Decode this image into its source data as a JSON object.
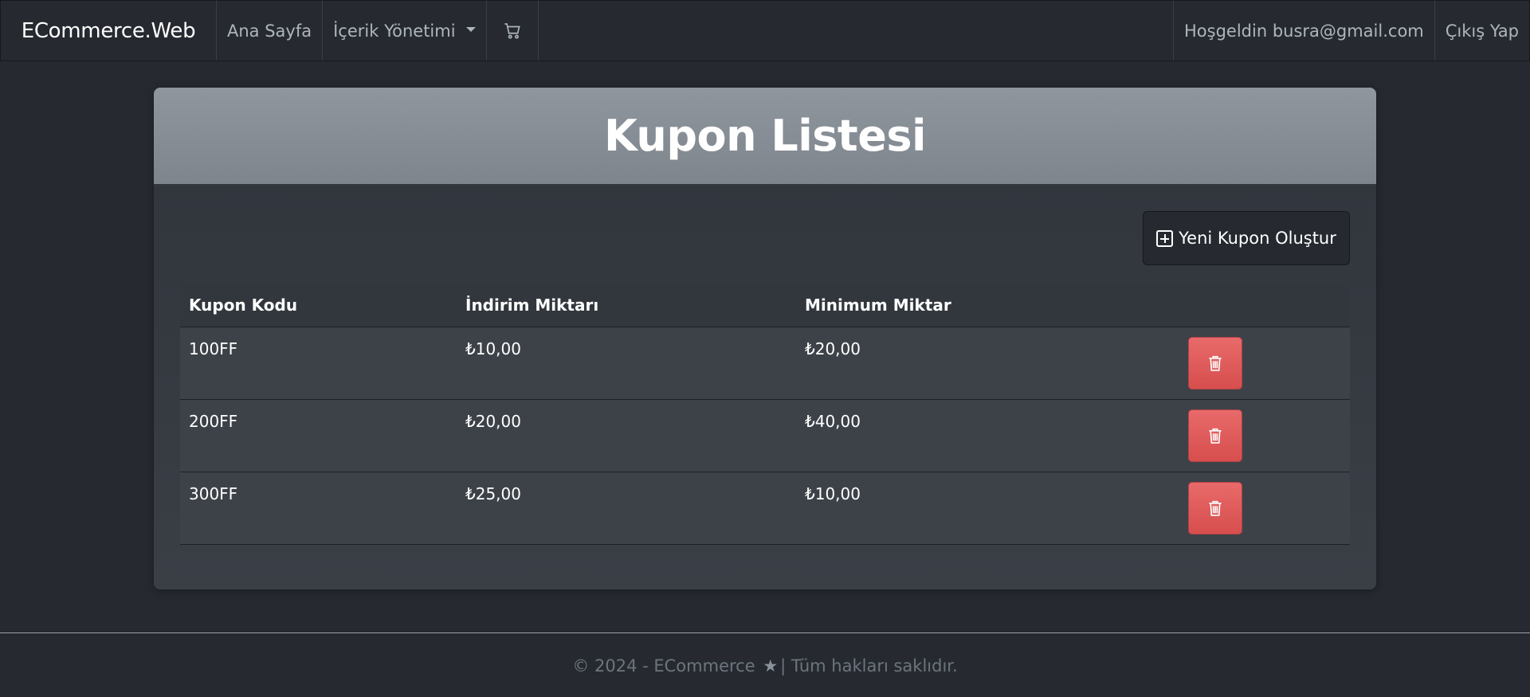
{
  "navbar": {
    "brand": "ECommerce.Web",
    "home": "Ana Sayfa",
    "content_management": "İçerik Yönetimi",
    "cart_icon": "cart-icon",
    "welcome": "Hoşgeldin busra@gmail.com",
    "logout": "Çıkış Yap"
  },
  "page": {
    "title": "Kupon Listesi",
    "new_coupon_label": "Yeni Kupon Oluştur"
  },
  "table": {
    "headers": [
      "Kupon Kodu",
      "İndirim Miktarı",
      "Minimum Miktar"
    ],
    "rows": [
      {
        "code": "100FF",
        "discount": "₺10,00",
        "minimum": "₺20,00"
      },
      {
        "code": "200FF",
        "discount": "₺20,00",
        "minimum": "₺40,00"
      },
      {
        "code": "300FF",
        "discount": "₺25,00",
        "minimum": "₺10,00"
      }
    ]
  },
  "footer": {
    "left": "© 2024 - ECommerce",
    "right": "| Tüm hakları saklıdır."
  },
  "colors": {
    "delete_button": "#e15b5b",
    "header_band": "#878e95",
    "background": "#262a30"
  }
}
